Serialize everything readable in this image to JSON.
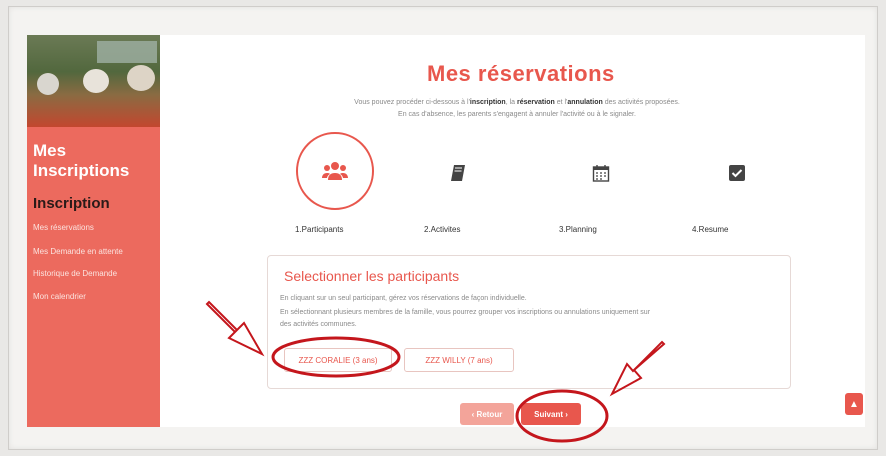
{
  "page": {
    "title": "Mes réservations",
    "intro_line1_pre": "Vous pouvez procéder ci-dessous à l'",
    "intro_bold1": "inscription",
    "intro_mid1": ", la ",
    "intro_bold2": "réservation",
    "intro_mid2": " et l'",
    "intro_bold3": "annulation",
    "intro_line1_post": " des activités proposées.",
    "intro_line2": "En cas d'absence, les parents s'engagent à annuler l'activité ou à le signaler."
  },
  "sidebar": {
    "title_line1": "Mes",
    "title_line2": "Inscriptions",
    "section": "Inscription",
    "links": [
      "Mes réservations",
      "Mes Demande en attente",
      "Historique de Demande",
      "Mon calendrier"
    ]
  },
  "steps": [
    {
      "label": "1.Participants",
      "icon": "users-icon",
      "active": true
    },
    {
      "label": "2.Activites",
      "icon": "book-icon",
      "active": false
    },
    {
      "label": "3.Planning",
      "icon": "calendar-icon",
      "active": false
    },
    {
      "label": "4.Resume",
      "icon": "check-square-icon",
      "active": false
    }
  ],
  "panel": {
    "title": "Selectionner les participants",
    "text1": "En cliquant sur un seul participant, gérez vos réservations de façon individuelle.",
    "text2": "En sélectionnant plusieurs membres de la famille, vous pourrez grouper vos inscriptions ou annulations uniquement sur",
    "text3": "des activités communes.",
    "participants": [
      "ZZZ CORALIE (3 ans)",
      "ZZZ WILLY (7 ans)"
    ]
  },
  "nav": {
    "prev": "‹ Retour",
    "next": "Suivant ›"
  },
  "colors": {
    "accent": "#e8574d",
    "sidebar": "#ec6a5e",
    "annotation": "#c4161c"
  }
}
